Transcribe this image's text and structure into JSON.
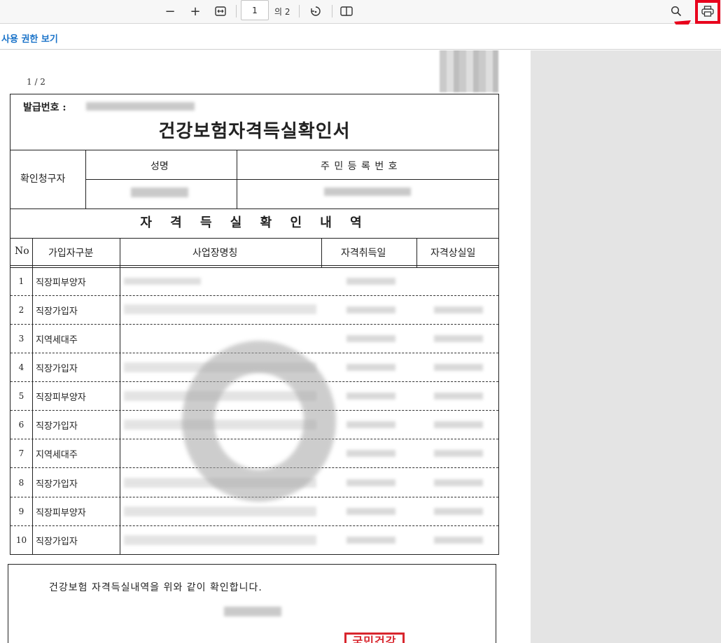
{
  "toolbar": {
    "zoom_out_icon": "minus-icon",
    "zoom_in_icon": "plus-icon",
    "fit_width_icon": "fit-width-icon",
    "page_current": "1",
    "page_total": "의 2",
    "rotate_icon": "rotate-icon",
    "two_page_icon": "two-page-view-icon",
    "search_icon": "search-icon",
    "print_icon": "printer-icon",
    "highlight_color": "#e8001c"
  },
  "subbar": {
    "permission_link": "사용 권한 보기",
    "link_color": "#1a73c9"
  },
  "document": {
    "page_indicator": "1 / 2",
    "issue_number_label": "발급번호 :",
    "title": "건강보험자격득실확인서",
    "requester_label": "확인청구자",
    "name_header": "성명",
    "rrn_header": "주 민 등 록 번 호",
    "section_title": "자 격 득 실 확 인 내 역",
    "columns": [
      "No",
      "가입자구분",
      "사업장명칭",
      "자격취득일",
      "자격상실일"
    ],
    "rows": [
      {
        "no": "1",
        "type": "직장피부양자"
      },
      {
        "no": "2",
        "type": "직장가입자"
      },
      {
        "no": "3",
        "type": "지역세대주"
      },
      {
        "no": "4",
        "type": "직장가입자"
      },
      {
        "no": "5",
        "type": "직장피부양자"
      },
      {
        "no": "6",
        "type": "직장가입자"
      },
      {
        "no": "7",
        "type": "지역세대주"
      },
      {
        "no": "8",
        "type": "직장가입자"
      },
      {
        "no": "9",
        "type": "직장피부양자"
      },
      {
        "no": "10",
        "type": "직장가입자"
      }
    ],
    "confirm_text": "건강보험 자격득실내역을 위와 같이 확인합니다.",
    "stamp_text": "국민건강",
    "stamp_color": "#d8262e"
  }
}
